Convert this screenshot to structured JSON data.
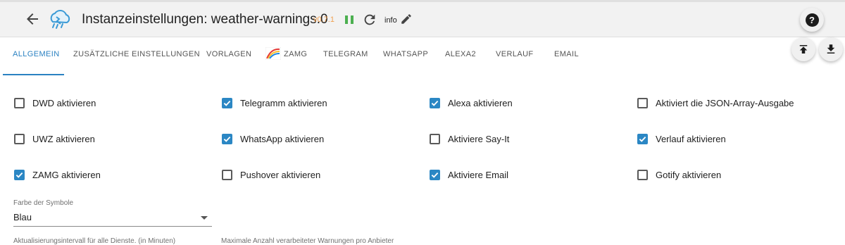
{
  "header": {
    "title": "Instanzeinstellungen: weather-warnings.0",
    "version": "v0.7.1",
    "info_label": "info",
    "help_icon": "?"
  },
  "tabs": [
    {
      "label": "ALLGEMEIN",
      "active": true
    },
    {
      "label": "ZUSÄTZLICHE EINSTELLUNGEN"
    },
    {
      "label": "VORLAGEN"
    },
    {
      "label": "ZAMG"
    },
    {
      "label": "TELEGRAM"
    },
    {
      "label": "WHATSAPP"
    },
    {
      "label": "ALEXA2"
    },
    {
      "label": "VERLAUF"
    },
    {
      "label": "EMAIL"
    }
  ],
  "checkboxes": [
    {
      "label": "DWD aktivieren",
      "checked": false
    },
    {
      "label": "Telegramm aktivieren",
      "checked": true
    },
    {
      "label": "Alexa aktivieren",
      "checked": true
    },
    {
      "label": "Aktiviert die JSON-Array-Ausgabe",
      "checked": false
    },
    {
      "label": "UWZ aktivieren",
      "checked": false
    },
    {
      "label": "WhatsApp aktivieren",
      "checked": true
    },
    {
      "label": "Aktiviere Say-It",
      "checked": false
    },
    {
      "label": "Verlauf aktivieren",
      "checked": true
    },
    {
      "label": "ZAMG aktivieren",
      "checked": true
    },
    {
      "label": "Pushover aktivieren",
      "checked": false
    },
    {
      "label": "Aktiviere Email",
      "checked": true
    },
    {
      "label": "Gotify aktivieren",
      "checked": false
    }
  ],
  "symbol_color": {
    "label": "Farbe der Symbole",
    "value": "Blau"
  },
  "interval_label": "Aktualisierungsintervall für alle Dienste. (in Minuten)",
  "max_warnings_label": "Maximale Anzahl verarbeiteter Warnungen pro Anbieter",
  "colors": {
    "accent": "#2b82c2",
    "checkbox": "#2b87c4",
    "version": "#f0a050",
    "pause": "#4caf50"
  },
  "icons": [
    "back-arrow-icon",
    "weather-logo-icon",
    "pause-icon",
    "reload-icon",
    "pencil-icon",
    "help-icon",
    "upload-icon",
    "download-icon",
    "zamg-logo-icon",
    "check-icon",
    "dropdown-arrow-icon"
  ]
}
